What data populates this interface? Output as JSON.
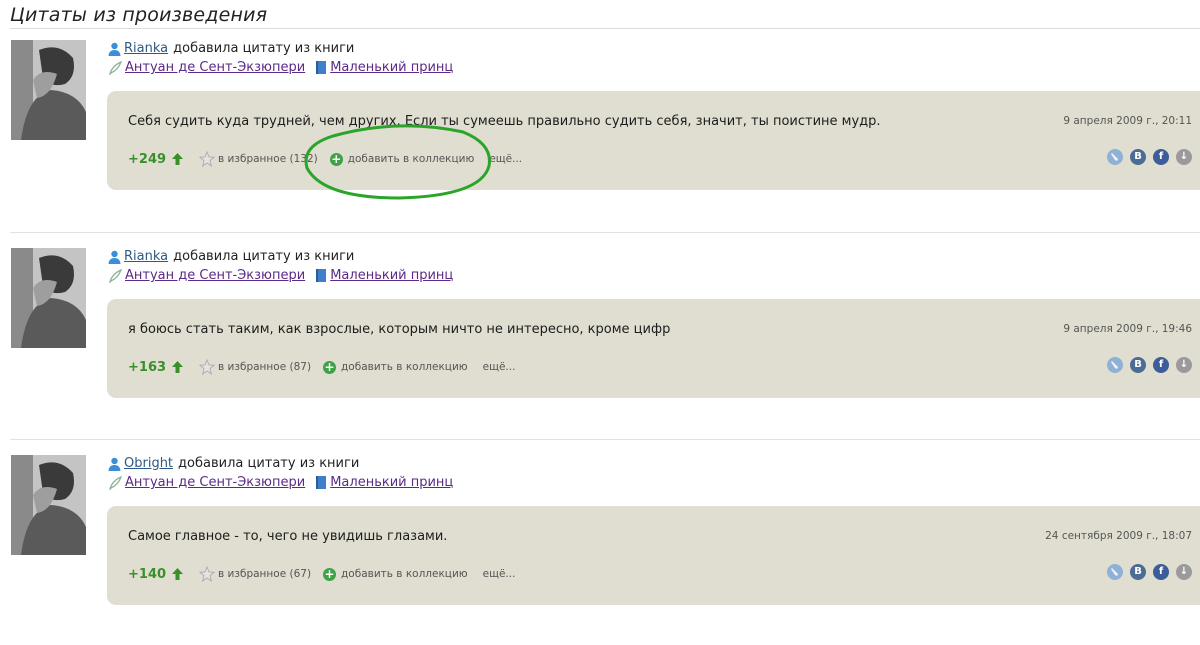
{
  "page": {
    "title": "Цитаты из произведения"
  },
  "quotes": [
    {
      "user": "Rianka",
      "action": "добавила цитату из книги",
      "author": "Антуан де Сент-Экзюпери",
      "book": "Маленький принц",
      "text": "Себя судить куда трудней, чем других. Если ты сумеешь правильно судить себя, значит, ты поистине мудр.",
      "date": "9 апреля 2009 г., 20:11",
      "score": "+249",
      "favorites": "в избранное (132)",
      "collection": "добавить в коллекцию",
      "more": "ещё..."
    },
    {
      "user": "Rianka",
      "action": "добавила цитату из книги",
      "author": "Антуан де Сент-Экзюпери",
      "book": "Маленький принц",
      "text": "я боюсь стать таким, как взрослые, которым ничто не интересно, кроме цифр",
      "date": "9 апреля 2009 г., 19:46",
      "score": "+163",
      "favorites": "в избранное (87)",
      "collection": "добавить в коллекцию",
      "more": "ещё..."
    },
    {
      "user": "Obright",
      "action": "добавила цитату из книги",
      "author": "Антуан де Сент-Экзюпери",
      "book": "Маленький принц",
      "text": "Самое главное - то, чего не увидишь глазами.",
      "date": "24 сентября 2009 г., 18:07",
      "score": "+140",
      "favorites": "в избранное (67)",
      "collection": "добавить в коллекцию",
      "more": "ещё..."
    }
  ],
  "social_icons": [
    "livejournal-icon",
    "vkontakte-icon",
    "facebook-icon",
    "download-icon"
  ],
  "social_glyphs": {
    "vk": "B",
    "fb": "f",
    "dl": "↓"
  },
  "colors": {
    "card": "#e0ded0",
    "score": "#3a8f2b",
    "highlight": "#2aa52a"
  }
}
